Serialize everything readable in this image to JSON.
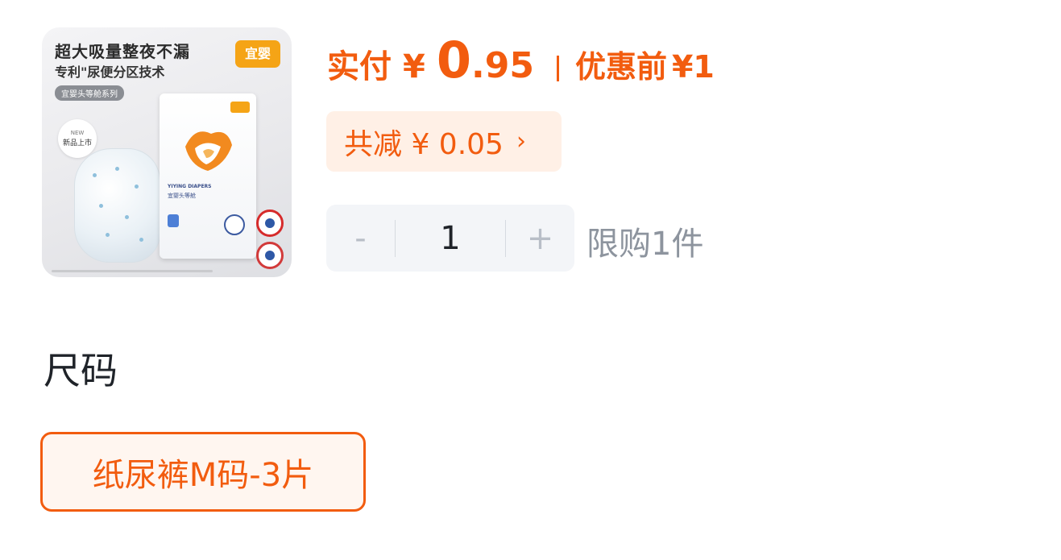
{
  "product_image": {
    "headline": "超大吸量整夜不漏",
    "subline": "专利\"尿便分区技术",
    "series_tag": "宜婴头等舱系列",
    "brand_logo_text": "宜婴",
    "new_badge_top": "NEW",
    "new_badge_text": "新品上市",
    "pack_title": "YIYING DIAPERS",
    "pack_name": "宜婴头等舱"
  },
  "price": {
    "prefix": "实付",
    "currency": "¥",
    "integer": "0",
    "decimal": ".95",
    "before_label": "优惠前",
    "before_value": "¥1"
  },
  "discount": {
    "label": "共减 ¥ 0.05",
    "chevron": "›"
  },
  "quantity": {
    "minus": "-",
    "value": "1",
    "plus": "+",
    "limit_text": "限购1件"
  },
  "size": {
    "title": "尺码",
    "options": [
      {
        "label": "纸尿裤M码-3片",
        "selected": true
      }
    ]
  },
  "colors": {
    "accent": "#f25c0f",
    "accent_bg": "#fff0e6",
    "stepper_bg": "#f3f5f8",
    "muted_text": "#8d949e"
  }
}
